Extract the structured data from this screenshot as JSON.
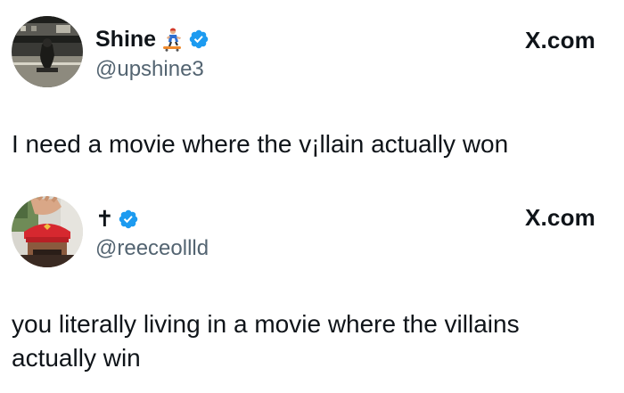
{
  "colors": {
    "text": "#0f1419",
    "secondary": "#536471",
    "verified": "#1d9bf0",
    "background": "#ffffff"
  },
  "posts": [
    {
      "display_name": "Shine",
      "name_emoji_icon": "skateboarder-emoji-icon",
      "verified_icon": "verified-badge-icon",
      "handle": "@upshine3",
      "source": "X.com",
      "text": "I need a movie where the v¡llain actually won"
    },
    {
      "display_name": "✝",
      "verified_icon": "verified-badge-icon",
      "handle": "@reeceollld",
      "source": "X.com",
      "text": "you literally living in a movie where the villains actually win"
    }
  ]
}
